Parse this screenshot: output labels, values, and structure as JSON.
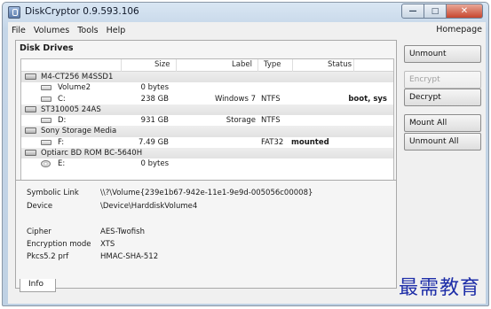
{
  "window": {
    "title": "DiskCryptor 0.9.593.106"
  },
  "menu": {
    "items": [
      {
        "label": "File"
      },
      {
        "label": "Volumes"
      },
      {
        "label": "Tools"
      },
      {
        "label": "Help"
      }
    ],
    "homepage": "Homepage"
  },
  "disk_drives": {
    "title": "Disk Drives",
    "columns": {
      "size": "Size",
      "label": "Label",
      "type": "Type",
      "status": "Status"
    },
    "rows": [
      {
        "kind": "disk",
        "name": "M4-CT256 M4SSD1",
        "icon": "hdd-icon"
      },
      {
        "kind": "volume",
        "name": "Volume2",
        "size": "0 bytes",
        "label": "",
        "type": "",
        "status": "",
        "icon": "volume-icon"
      },
      {
        "kind": "volume",
        "name": "C:",
        "size": "238 GB",
        "label": "Windows 7",
        "type": "NTFS",
        "status": "boot, sys",
        "icon": "volume-icon"
      },
      {
        "kind": "disk",
        "name": "ST310005 24AS",
        "icon": "hdd-icon"
      },
      {
        "kind": "volume",
        "name": "D:",
        "size": "931 GB",
        "label": "Storage",
        "type": "NTFS",
        "status": "",
        "icon": "volume-icon"
      },
      {
        "kind": "disk",
        "name": "Sony Storage Media",
        "icon": "hdd-icon"
      },
      {
        "kind": "volume",
        "name": "F:",
        "size": "7.49 GB",
        "label": "",
        "type": "FAT32",
        "status": "mounted",
        "icon": "volume-icon"
      },
      {
        "kind": "disk",
        "name": "Optiarc BD ROM BC-5640H",
        "icon": "hdd-icon"
      },
      {
        "kind": "volume",
        "name": "E:",
        "size": "0 bytes",
        "label": "",
        "type": "",
        "status": "",
        "icon": "cd-icon"
      }
    ]
  },
  "info": {
    "rows": [
      {
        "key": "Symbolic Link",
        "value": "\\\\?\\Volume{239e1b67-942e-11e1-9e9d-005056c00008}"
      },
      {
        "key": "Device",
        "value": "\\Device\\HarddiskVolume4"
      },
      {
        "key": "Cipher",
        "value": "AES-Twofish"
      },
      {
        "key": "Encryption mode",
        "value": "XTS"
      },
      {
        "key": "Pkcs5.2 prf",
        "value": "HMAC-SHA-512"
      }
    ],
    "tab": "Info"
  },
  "buttons": {
    "unmount": "Unmount",
    "encrypt": "Encrypt",
    "decrypt": "Decrypt",
    "mount_all": "Mount All",
    "unmount_all": "Unmount All"
  },
  "watermark": "最需教育"
}
